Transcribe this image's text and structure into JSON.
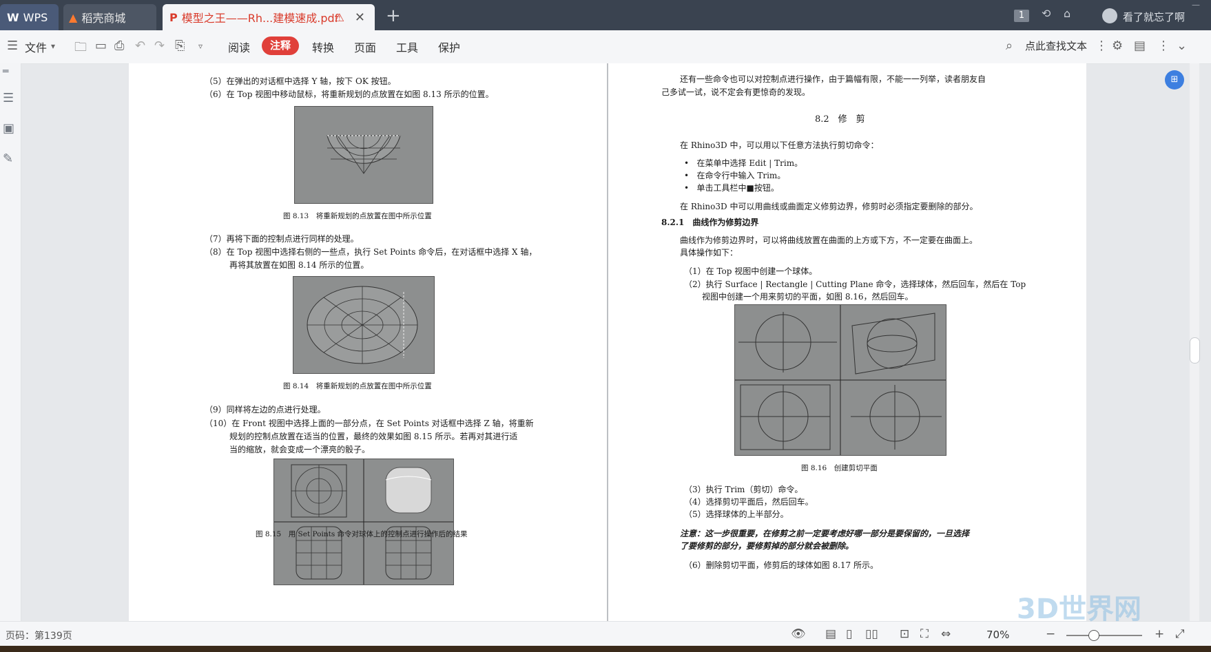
{
  "tabs": {
    "wps_label": "WPS",
    "store_label": "稻壳商城",
    "doc_label": "模型之王——Rh...建模速成.pdf",
    "new_tab": "+"
  },
  "header": {
    "badge_count": "1",
    "user_name": "看了就忘了啊"
  },
  "toolbar": {
    "file_label": "文件",
    "menus": [
      "阅读",
      "注释",
      "转换",
      "页面",
      "工具",
      "保护"
    ],
    "search_label": "点此查找文本"
  },
  "left_page": {
    "lines": [
      "（5）在弹出的对话框中选择 Y 轴，按下 OK 按钮。",
      "（6）在 Top 视图中移动鼠标，将重新规划的点放置在如图 8.13 所示的位置。",
      "（7）再将下面的控制点进行同样的处理。",
      "（8）在 Top 视图中选择右侧的一些点，执行 Set Points 命令后，在对话框中选择 X 轴，",
      "再将其放置在如图 8.14 所示的位置。",
      "（9）同样将左边的点进行处理。",
      "（10）在 Front 视图中选择上面的一部分点，在 Set Points 对话框中选择 Z 轴，将重新",
      "规划的控制点放置在适当的位置，最终的效果如图 8.15 所示。若再对其进行适",
      "当的缩放，就会变成一个漂亮的骰子。"
    ],
    "captions": [
      "图 8.13　将重新规划的点放置在图中所示位置",
      "图 8.14　将重新规划的点放置在图中所示位置",
      "图 8.15　用 Set Points 命令对球体上的控制点进行操作后的结果"
    ]
  },
  "right_page": {
    "intro": [
      "还有一些命令也可以对控制点进行操作，由于篇幅有限，不能一一列举，读者朋友自",
      "己多试一试，说不定会有更惊奇的发现。"
    ],
    "section_title": "8.2　修　剪",
    "trim_intro": "在 Rhino3D 中，可以用以下任意方法执行剪切命令：",
    "bullets": [
      "在菜单中选择 Edit | Trim。",
      "在命令行中输入 Trim。",
      "单击工具栏中■按钮。"
    ],
    "boundary_text": "在 Rhino3D 中可以用曲线或曲面定义修剪边界，修剪时必须指定要删除的部分。",
    "subsection": "8.2.1　曲线作为修剪边界",
    "sub_text": [
      "曲线作为修剪边界时，可以将曲线放置在曲面的上方或下方，不一定要在曲面上。",
      "具体操作如下："
    ],
    "steps_a": [
      "（1）在 Top 视图中创建一个球体。",
      "（2）执行 Surface | Rectangle | Cutting Plane 命令，选择球体，然后回车，然后在 Top",
      "视图中创建一个用来剪切的平面，如图 8.16，然后回车。"
    ],
    "caption": "图 8.16　创建剪切平面",
    "steps_b": [
      "（3）执行 Trim（剪切）命令。",
      "（4）选择剪切平面后，然后回车。",
      "（5）选择球体的上半部分。"
    ],
    "note": [
      "注意：这一步很重要，在修剪之前一定要考虑好哪一部分是要保留的，一旦选择",
      "了要修剪的部分，要修剪掉的部分就会被删除。"
    ],
    "step6": "（6）删除剪切平面，修剪后的球体如图 8.17 所示。"
  },
  "status": {
    "page_label": "页码：第139页",
    "zoom": "70%"
  },
  "watermark": "3D世界网"
}
